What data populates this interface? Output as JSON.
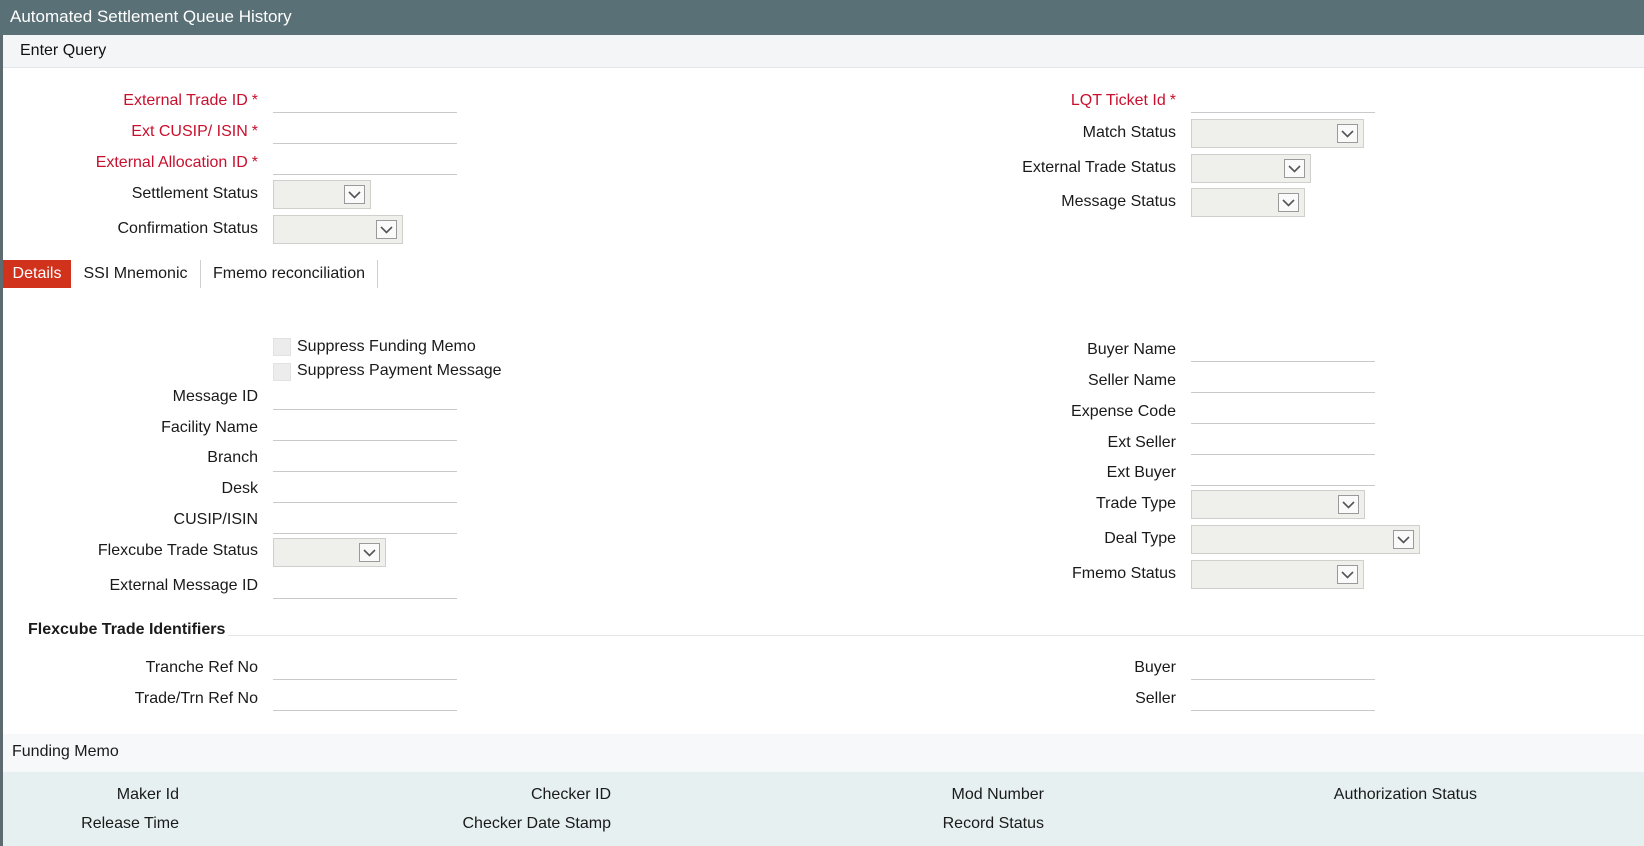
{
  "window": {
    "title": "Automated Settlement Queue History"
  },
  "toolbar": {
    "enter_query": "Enter Query"
  },
  "header_fields": {
    "external_trade_id": "External Trade ID",
    "ext_cusip_isin": "Ext CUSIP/ ISIN",
    "external_allocation_id": "External Allocation ID",
    "settlement_status": "Settlement Status",
    "confirmation_status": "Confirmation Status",
    "lqt_ticket_id": "LQT Ticket Id",
    "match_status": "Match Status",
    "external_trade_status": "External Trade Status",
    "message_status": "Message Status",
    "required_mark": "*"
  },
  "tabs": [
    {
      "label": "Details"
    },
    {
      "label": "SSI Mnemonic"
    },
    {
      "label": "Fmemo reconciliation"
    }
  ],
  "details": {
    "suppress_funding_memo": "Suppress Funding Memo",
    "suppress_payment_message": "Suppress Payment Message",
    "message_id": "Message ID",
    "facility_name": "Facility Name",
    "branch": "Branch",
    "desk": "Desk",
    "cusip_isin": "CUSIP/ISIN",
    "flexcube_trade_status": "Flexcube Trade Status",
    "external_message_id": "External Message ID",
    "buyer_name": "Buyer Name",
    "seller_name": "Seller Name",
    "expense_code": "Expense Code",
    "ext_seller": "Ext Seller",
    "ext_buyer": "Ext Buyer",
    "trade_type": "Trade Type",
    "deal_type": "Deal Type",
    "fmemo_status": "Fmemo Status"
  },
  "identifiers": {
    "heading": "Flexcube Trade Identifiers",
    "tranche_ref_no": "Tranche Ref No",
    "trade_trn_ref_no": "Trade/Trn Ref No",
    "buyer": "Buyer",
    "seller": "Seller"
  },
  "funding_memo": {
    "label": "Funding Memo"
  },
  "audit": {
    "maker_id": "Maker Id",
    "release_time": "Release Time",
    "checker_id": "Checker ID",
    "checker_date_stamp": "Checker Date Stamp",
    "mod_number": "Mod Number",
    "record_status": "Record Status",
    "authorization_status": "Authorization Status"
  },
  "colors": {
    "title_bar": "#587076",
    "required_label": "#c8102e",
    "active_tab": "#d0321c",
    "audit_bg": "#e6f0f1"
  }
}
